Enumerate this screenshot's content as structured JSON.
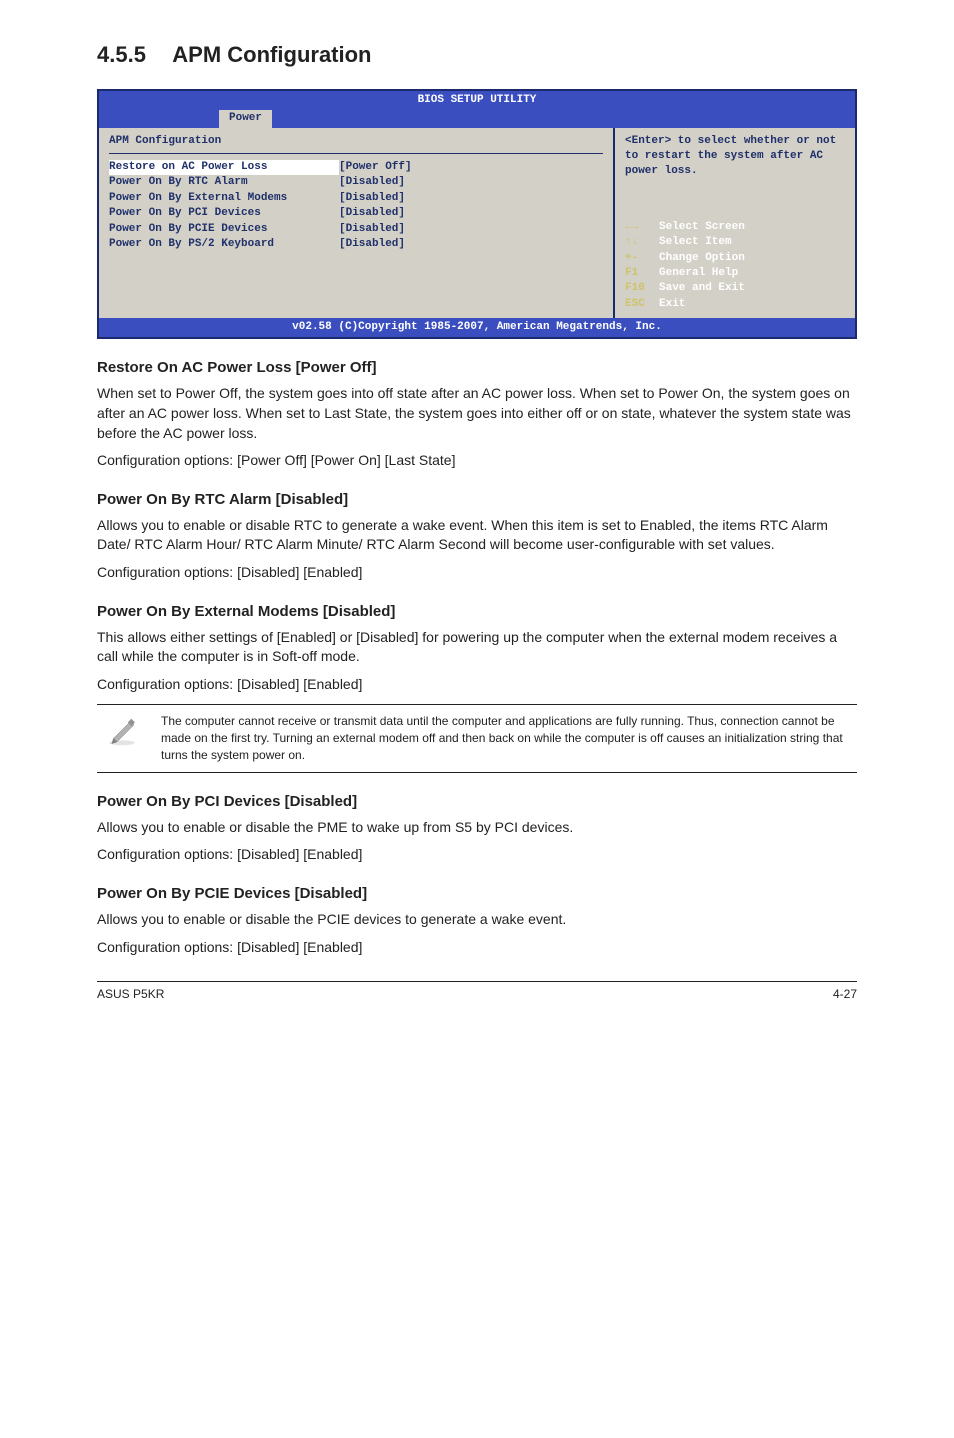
{
  "header": {
    "number": "4.5.5",
    "title": "APM Configuration"
  },
  "bios": {
    "title": "BIOS SETUP UTILITY",
    "tab": "Power",
    "section": "APM Configuration",
    "rows": [
      {
        "key": "Restore on AC Power Loss",
        "val": "[Power Off]"
      },
      {
        "key": "Power On By RTC Alarm",
        "val": "[Disabled]"
      },
      {
        "key": "Power On By External Modems",
        "val": "[Disabled]"
      },
      {
        "key": "Power On By PCI Devices",
        "val": "[Disabled]"
      },
      {
        "key": "Power On By PCIE Devices",
        "val": "[Disabled]"
      },
      {
        "key": "Power On By PS/2 Keyboard",
        "val": "[Disabled]"
      }
    ],
    "help": "<Enter> to select whether or not to restart the system after AC power loss.",
    "legend": [
      {
        "sym": "←→",
        "label": "Select Screen"
      },
      {
        "sym": "↑↓",
        "label": "Select Item"
      },
      {
        "sym": "+-",
        "label": "Change Option"
      },
      {
        "sym": "F1",
        "label": "General Help"
      },
      {
        "sym": "F10",
        "label": "Save and Exit"
      },
      {
        "sym": "ESC",
        "label": "Exit"
      }
    ],
    "footer": "v02.58 (C)Copyright 1985-2007, American Megatrends, Inc."
  },
  "sections": {
    "restore": {
      "title": "Restore On AC Power Loss [Power Off]",
      "body": "When set to Power Off, the system goes into off state after an AC power loss. When set to Power On, the system goes on after an AC power loss. When set to Last State, the system goes into either off or on state, whatever the system state was before the AC power loss.",
      "opts": "Configuration options: [Power Off] [Power On] [Last State]"
    },
    "rtc": {
      "title": "Power On By RTC Alarm [Disabled]",
      "body": "Allows you to enable or disable RTC to generate a wake event. When this item is set to Enabled, the items RTC Alarm Date/ RTC Alarm Hour/ RTC Alarm Minute/ RTC Alarm Second will become user-configurable with set values.",
      "opts": "Configuration options: [Disabled] [Enabled]"
    },
    "modem": {
      "title": "Power On By External Modems [Disabled]",
      "body": "This allows either settings of [Enabled] or [Disabled] for powering up the computer when the external modem receives a call while the computer is in Soft-off mode.",
      "opts": "Configuration options: [Disabled] [Enabled]"
    },
    "note": "The computer cannot receive or transmit data until the computer and applications are fully running. Thus, connection cannot be made on the first try. Turning an external modem off and then back on while the computer is off causes an initialization string that turns the system power on.",
    "pci": {
      "title": "Power On By PCI Devices [Disabled]",
      "body": "Allows you to enable or disable the PME to wake up from S5 by PCI devices.",
      "opts": "Configuration options: [Disabled] [Enabled]"
    },
    "pcie": {
      "title": "Power On By PCIE Devices [Disabled]",
      "body": "Allows you to enable or disable the PCIE devices to generate a wake event.",
      "opts": "Configuration options: [Disabled] [Enabled]"
    }
  },
  "footer": {
    "left": "ASUS P5KR",
    "right": "4-27"
  }
}
